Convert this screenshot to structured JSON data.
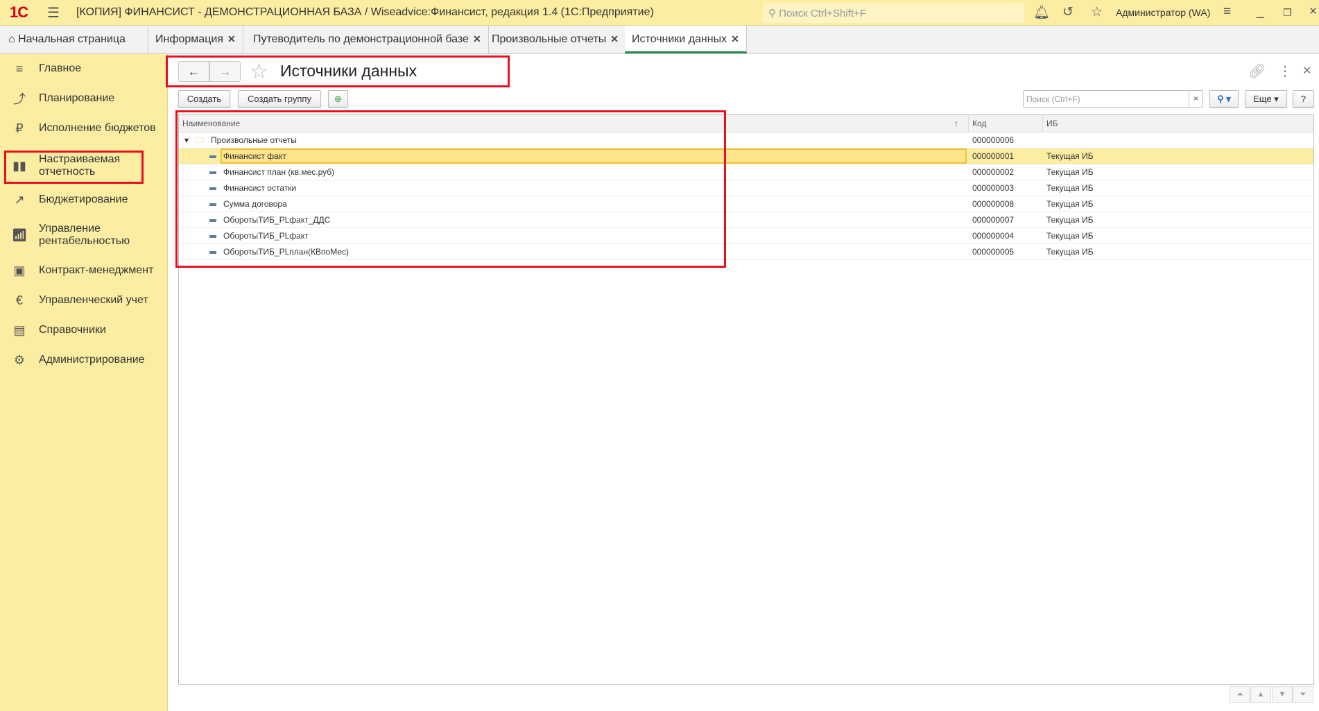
{
  "app": {
    "title": "[КОПИЯ] ФИНАНСИСТ - ДЕМОНСТРАЦИОННАЯ БАЗА / Wiseadvice:Финансист, редакция 1.4  (1С:Предприятие)",
    "logo": "1С",
    "search_placeholder": "Поиск Ctrl+Shift+F",
    "user": "Администратор (WA)"
  },
  "tabs": [
    {
      "label": "Начальная страница"
    },
    {
      "label": "Информация"
    },
    {
      "label": "Путеводитель по демонстрационной базе"
    },
    {
      "label": "Произвольные отчеты"
    },
    {
      "label": "Источники данных"
    }
  ],
  "sidebar": {
    "items": [
      {
        "label": "Главное"
      },
      {
        "label": "Планирование"
      },
      {
        "label": "Исполнение бюджетов"
      },
      {
        "label": "Настраиваемая отчетность"
      },
      {
        "label": "Бюджетирование"
      },
      {
        "label": "Управление рентабельностью"
      },
      {
        "label": "Контракт-менеджмент"
      },
      {
        "label": "Управленческий учет"
      },
      {
        "label": "Справочники"
      },
      {
        "label": "Администрирование"
      }
    ]
  },
  "page": {
    "title": "Источники данных"
  },
  "toolbar": {
    "create": "Создать",
    "create_group": "Создать группу",
    "search_placeholder": "Поиск (Ctrl+F)",
    "clear": "×",
    "more": "Еще ▾",
    "help": "?"
  },
  "table": {
    "columns": [
      "Наименование",
      "Код",
      "ИБ"
    ],
    "sort_indicator": "↑",
    "group": {
      "name": "Произвольные отчеты",
      "code": "000000006"
    },
    "rows": [
      {
        "name": "Финансист факт",
        "code": "000000001",
        "ib": "Текущая ИБ"
      },
      {
        "name": "Финансист план (кв.мес.руб)",
        "code": "000000002",
        "ib": "Текущая ИБ"
      },
      {
        "name": "Финансист остатки",
        "code": "000000003",
        "ib": "Текущая ИБ"
      },
      {
        "name": "Сумма договора",
        "code": "000000008",
        "ib": "Текущая ИБ"
      },
      {
        "name": "ОборотыТИБ_PLфакт_ДДС",
        "code": "000000007",
        "ib": "Текущая ИБ"
      },
      {
        "name": "ОборотыТИБ_PLфакт",
        "code": "000000004",
        "ib": "Текущая ИБ"
      },
      {
        "name": "ОборотыТИБ_PLплан(КВпоМес)",
        "code": "000000005",
        "ib": "Текущая ИБ"
      }
    ]
  },
  "colors": {
    "accent": "#fbeda2",
    "highlight": "#e8101f",
    "active_tab": "#2d8a4e"
  }
}
